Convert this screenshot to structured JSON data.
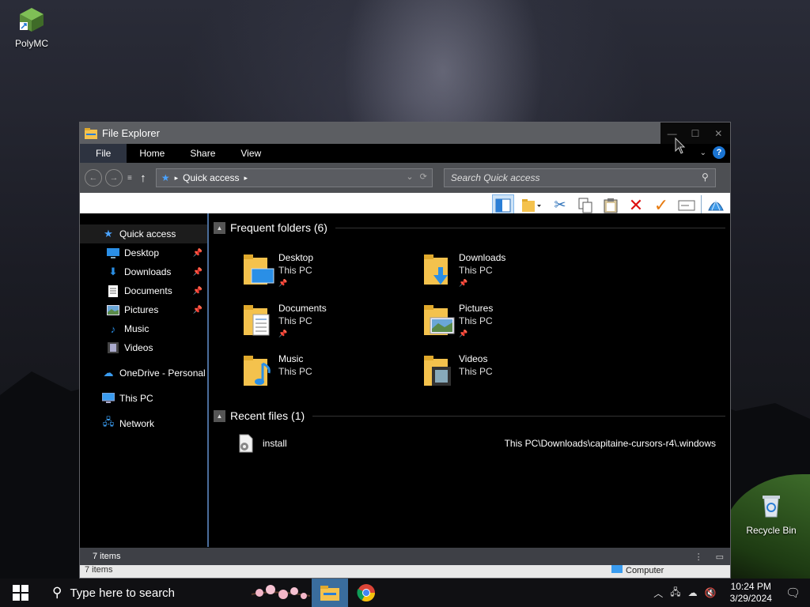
{
  "desktop": {
    "icons": [
      {
        "label": "PolyMC",
        "icon": "polymc-icon"
      },
      {
        "label": "Recycle Bin",
        "icon": "recycle-bin-icon"
      }
    ]
  },
  "window": {
    "title": "File Explorer",
    "controls": {
      "minimize": "—",
      "maximize": "☐",
      "close": "✕"
    }
  },
  "ribbon": {
    "tabs": [
      "File",
      "Home",
      "Share",
      "View"
    ],
    "help": "?"
  },
  "address": {
    "location": "Quick access",
    "search_placeholder": "Search Quick access"
  },
  "nav": {
    "quick_access": "Quick access",
    "pinned": [
      {
        "label": "Desktop",
        "pinned": true
      },
      {
        "label": "Downloads",
        "pinned": true
      },
      {
        "label": "Documents",
        "pinned": true
      },
      {
        "label": "Pictures",
        "pinned": true
      },
      {
        "label": "Music",
        "pinned": false
      },
      {
        "label": "Videos",
        "pinned": false
      }
    ],
    "onedrive": "OneDrive - Personal",
    "this_pc": "This PC",
    "network": "Network"
  },
  "content": {
    "frequent_title": "Frequent folders (6)",
    "folders": [
      {
        "name": "Desktop",
        "location": "This PC",
        "pinned": true
      },
      {
        "name": "Downloads",
        "location": "This PC",
        "pinned": true
      },
      {
        "name": "Documents",
        "location": "This PC",
        "pinned": true
      },
      {
        "name": "Pictures",
        "location": "This PC",
        "pinned": true
      },
      {
        "name": "Music",
        "location": "This PC",
        "pinned": false
      },
      {
        "name": "Videos",
        "location": "This PC",
        "pinned": false
      }
    ],
    "recent_title": "Recent files (1)",
    "recent": [
      {
        "name": "install",
        "path": "This PC\\Downloads\\capitaine-cursors-r4\\.windows"
      }
    ]
  },
  "status": {
    "items": "7 items",
    "items2": "7 items",
    "location": "Computer"
  },
  "taskbar": {
    "search_text": "Type here to search",
    "time": "10:24 PM",
    "date": "3/29/2024"
  },
  "colors": {
    "accent": "#1a74d3",
    "titlebar": "#5c5e62",
    "taskbar_active": "#3a6d9d"
  }
}
